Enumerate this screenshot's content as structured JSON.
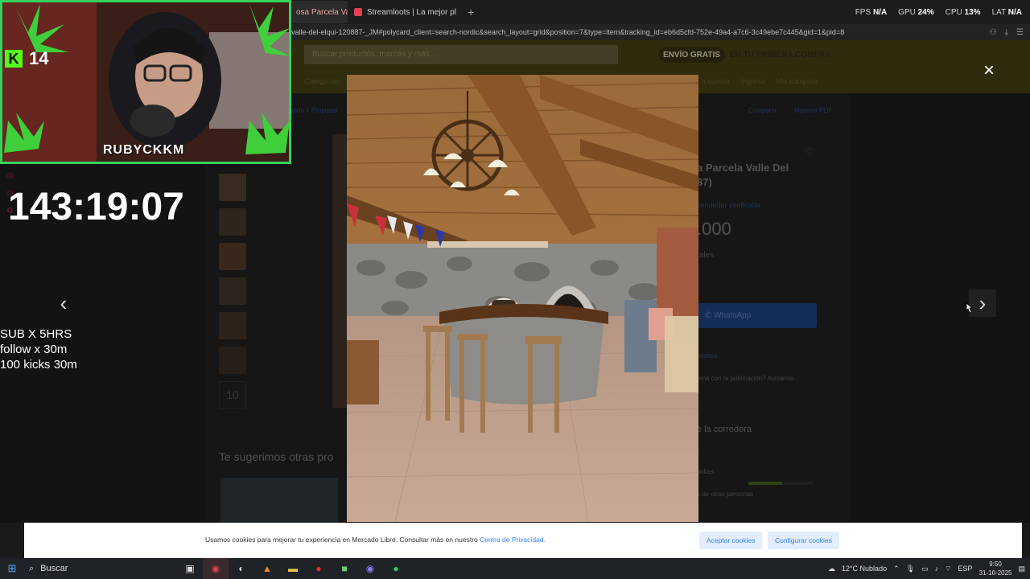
{
  "browser": {
    "tabs": [
      {
        "label": "osa Parcela Valle",
        "active": true
      },
      {
        "label": "Streamloots | La mejor pl",
        "active": false
      }
    ],
    "new_tab": "+",
    "url": "valle-del-elqui-120887-_JM#polycard_client=search-nordic&search_layout=grid&position=7&type=item&tracking_id=eb6d5cfd-752e-49a4-a7c6-3c49ebe7c445&gid=1&pid=8"
  },
  "perf": {
    "fps_label": "FPS",
    "fps_value": "N/A",
    "gpu_label": "GPU",
    "gpu_value": "24%",
    "cpu_label": "CPU",
    "cpu_value": "13%",
    "lat_label": "LAT",
    "lat_value": "N/A"
  },
  "ml": {
    "search_placeholder": "Buscar productos, marcas y más…",
    "envio_badge": "ENVÍO GRATIS",
    "envio_text_1": "EN TU",
    "envio_text_2": "PRIMERA COMPRA",
    "nav_left": "Categorías",
    "nav_right": [
      "n cuenta",
      "Ingresa",
      "Mis compras"
    ],
    "breadcrumb": "ando > Propieda",
    "top_links": [
      "Compartir",
      "Imprimir PDF"
    ],
    "suggest_title": "Te sugerimos otras pro",
    "thumb_more": "10",
    "title": "a Parcela Valle Del\n87)",
    "verified": "vendedor verificada",
    "price": ".000",
    "label_totales": "tales",
    "whatsapp": "WhatsApp",
    "consultas": "nsultas",
    "problem": "ema con la publicación? Avisanos.",
    "corredora": "e la corredora",
    "consultas2": "sultas",
    "other_people": "s de otras personas"
  },
  "lightbox": {
    "close_icon": "×",
    "prev_icon": "‹",
    "next_icon": "›"
  },
  "overlay": {
    "kick_count": "14",
    "nametag": "RUBYCKKM",
    "timer": "143:19:07",
    "sub_lines": [
      "SUB X 5HRS",
      "follow x 30m",
      "100 kicks 30m"
    ]
  },
  "cookies": {
    "text": "Usamos cookies para mejorar tu experiencia en Mercado Libre. Consultar más en nuestro",
    "link": "Centro de Privacidad.",
    "accept": "Aceptar cookies",
    "configure": "Configurar cookies"
  },
  "taskbar": {
    "search": "Buscar",
    "weather": "12°C  Nublado",
    "lang": "ESP",
    "time": "9:50",
    "date": "31-10-2025"
  },
  "colors": {
    "kick_green": "#53fc18",
    "ml_link": "#3483fa"
  }
}
